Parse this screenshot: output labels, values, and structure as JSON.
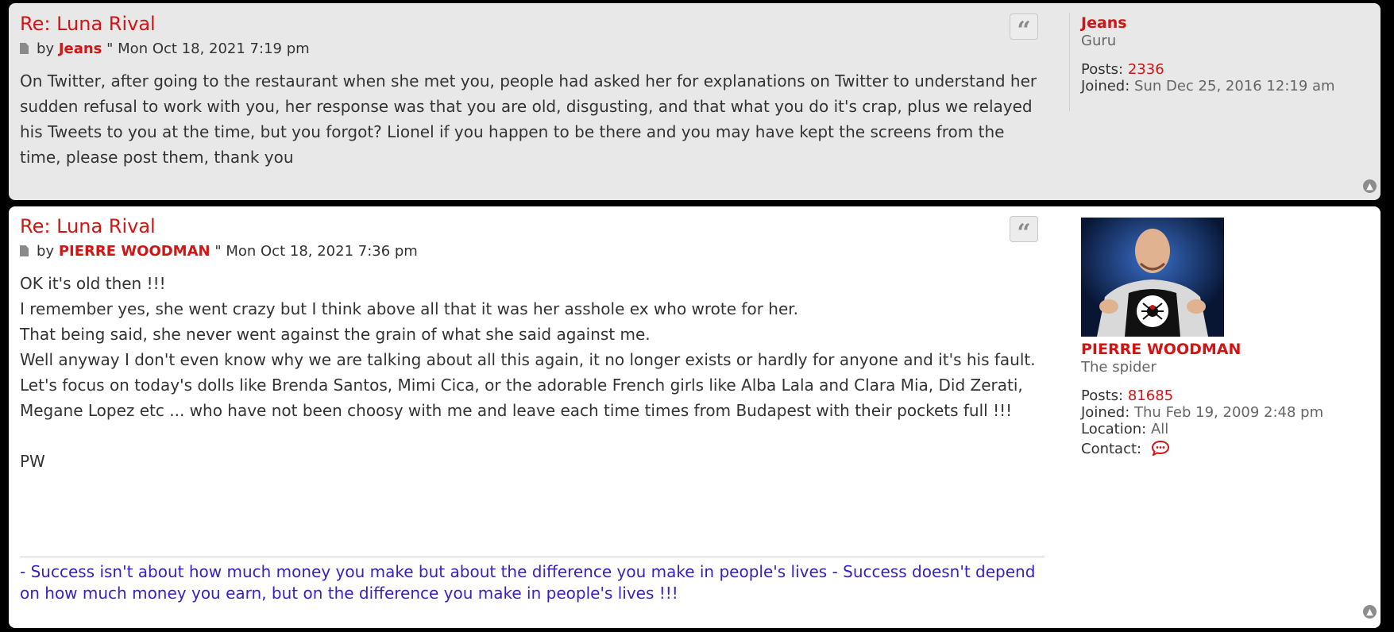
{
  "posts": [
    {
      "title": "Re: Luna Rival",
      "by": "by",
      "author": "Jeans",
      "separator": "\"",
      "date": "Mon Oct 18, 2021 7:19 pm",
      "body": [
        "On Twitter, after going to the restaurant when she met you, people had asked her for explanations on Twitter to understand her sudden refusal to work with you, her response was that you are old, disgusting, and that what you do it's crap, plus we relayed his Tweets to you at the time, but you forgot? Lionel if you happen to be there and you may have kept the screens from the time, please post them, thank you"
      ],
      "profile": {
        "username": "Jeans",
        "rank": "Guru",
        "posts_label": "Posts:",
        "posts_value": "2336",
        "joined_label": "Joined:",
        "joined_value": "Sun Dec 25, 2016 12:19 am"
      }
    },
    {
      "title": "Re: Luna Rival",
      "by": "by",
      "author": "PIERRE WOODMAN",
      "separator": "\"",
      "date": "Mon Oct 18, 2021 7:36 pm",
      "body": [
        "OK it's old then !!!",
        "I remember yes, she went crazy but I think above all that it was her asshole ex who wrote for her.",
        "That being said, she never went against the grain of what she said against me.",
        "Well anyway I don't even know why we are talking about all this again, it no longer exists or hardly for anyone and it's his fault.",
        "Let's focus on today's dolls like Brenda Santos, Mimi Cica, or the adorable French girls like Alba Lala and Clara Mia, Did Zerati, Megane Lopez etc ... who have not been choosy with me and leave each time times from Budapest with their pockets full !!!",
        "",
        "PW"
      ],
      "signature": "- Success isn't about how much money you make but about the difference you make in people's lives - Success doesn't depend on how much money you earn, but on the difference you make in people's lives !!!",
      "profile": {
        "username": "PIERRE WOODMAN",
        "rank": "The spider",
        "posts_label": "Posts:",
        "posts_value": "81685",
        "joined_label": "Joined:",
        "joined_value": "Thu Feb 19, 2009 2:48 pm",
        "location_label": "Location:",
        "location_value": "All",
        "contact_label": "Contact:"
      }
    }
  ],
  "icons": {
    "quote": "quote-icon",
    "top": "arrow-up-circle-icon",
    "post": "file-icon",
    "contact": "speech-bubble-icon"
  },
  "colors": {
    "accent_red": "#d31414",
    "signature_purple": "#3b1ebf",
    "post_bg_alt": "#e8e8e8",
    "post_bg": "#ffffff"
  }
}
